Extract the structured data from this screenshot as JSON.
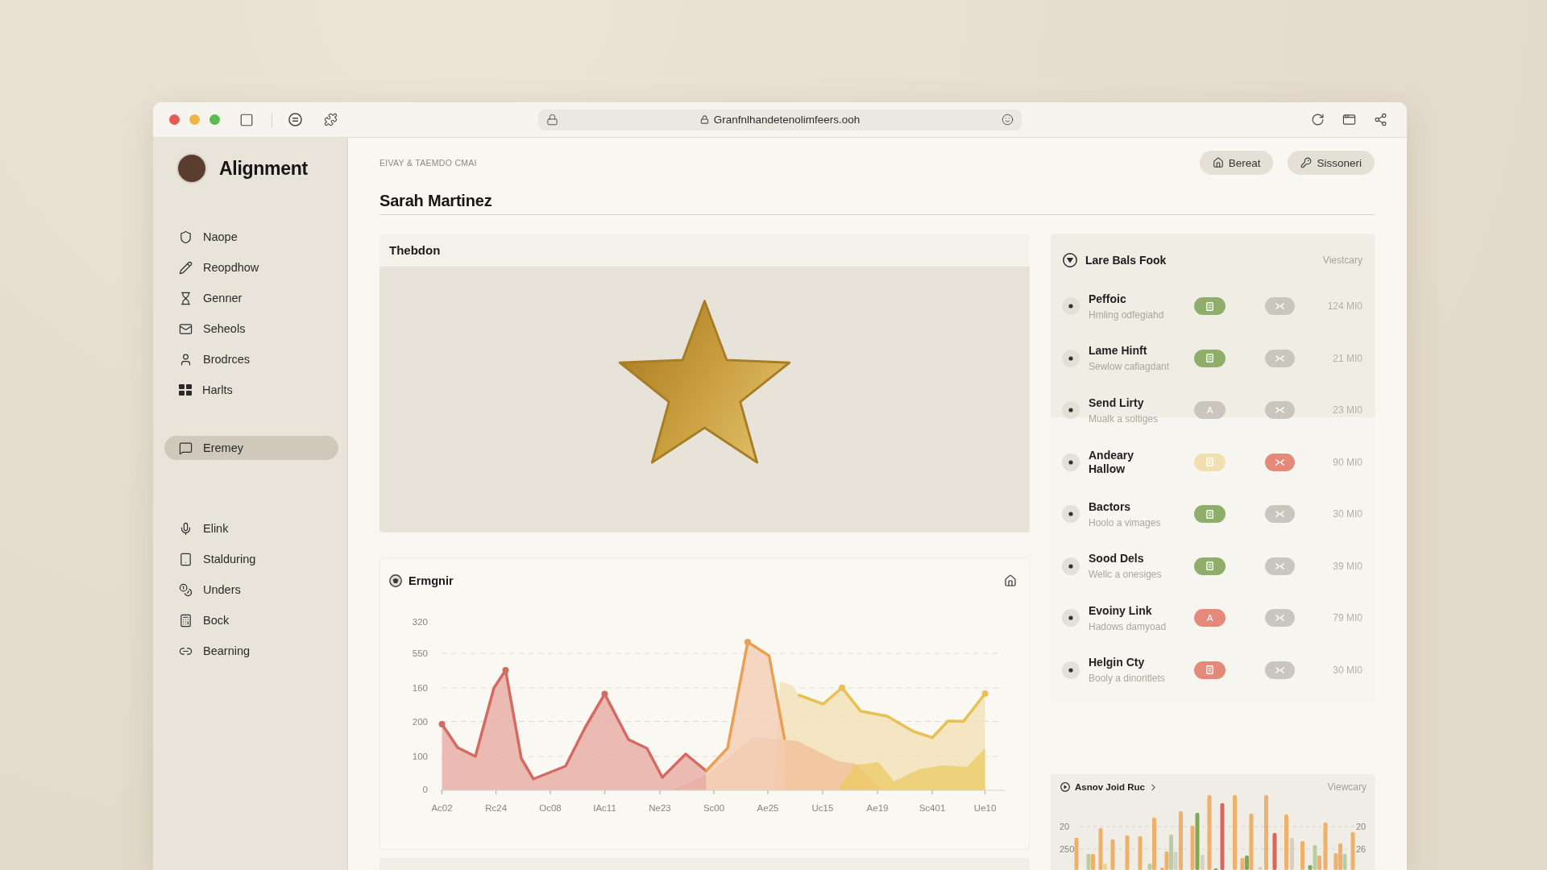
{
  "browser": {
    "url": "Granfnlhandetenolimfeers.ooh"
  },
  "sidebar": {
    "brand": "Alignment",
    "sections": [
      {
        "items": [
          {
            "label": "Naope",
            "selected": false
          },
          {
            "label": "Reopdhow",
            "selected": false
          },
          {
            "label": "Genner",
            "selected": false
          },
          {
            "label": "Seheols",
            "selected": false
          },
          {
            "label": "Brodrces",
            "selected": false
          },
          {
            "label": "Harlts",
            "selected": false
          }
        ]
      },
      {
        "items": [
          {
            "label": "Eremey",
            "selected": true
          }
        ]
      },
      {
        "items": [
          {
            "label": "Elink",
            "selected": false
          },
          {
            "label": "Stalduring",
            "selected": false
          },
          {
            "label": "Unders",
            "selected": false
          },
          {
            "label": "Bock",
            "selected": false
          },
          {
            "label": "Bearning",
            "selected": false
          }
        ]
      }
    ]
  },
  "header": {
    "breadcrumb": "EIVAY & TAEMDO CMAI",
    "title": "Sarah Martinez",
    "actions": [
      {
        "label": "Bereat"
      },
      {
        "label": "Sissoneri"
      }
    ]
  },
  "image_card": {
    "title": "Thebdon"
  },
  "chart_card": {
    "title": "Ermgnir",
    "y_labels": [
      "320",
      "550",
      "160",
      "200",
      "100",
      "0"
    ],
    "x_labels": [
      "Ac02",
      "Rc24",
      "Oc08",
      "IAc11",
      "Ne23",
      "Sc00",
      "Ae25",
      "Uc15",
      "Ae19",
      "Sc401",
      "Ue10"
    ]
  },
  "list_panel": {
    "title": "Lare Bals Fook",
    "link": "Viestcary",
    "rows": [
      {
        "name": "Peffoic",
        "subtitle": "Hmling odfegiahd",
        "tag": {
          "color": "#8fae6c"
        },
        "flag": {
          "color": "#cbc6bd"
        },
        "value": "124 MI0"
      },
      {
        "name": "Lame Hinft",
        "subtitle": "Sewlow cafiagdant",
        "tag": {
          "color": "#8fae6c"
        },
        "flag": {
          "color": "#cbc6bd"
        },
        "value": "21 MI0"
      },
      {
        "name": "Send Lirty",
        "subtitle": "Mualk a soltiges",
        "tag": {
          "color": "#cbc6bd",
          "label": "A"
        },
        "flag": {
          "color": "#cbc6bd"
        },
        "value": "23 MI0"
      },
      {
        "name": "Andeary Hallow",
        "tag": {
          "color": "#f1dfb2"
        },
        "flag": {
          "color": "#e5897a"
        },
        "value": "90 MI0"
      },
      {
        "name": "Bactors",
        "subtitle": "Hoolo a vimages",
        "tag": {
          "color": "#8fae6c"
        },
        "flag": {
          "color": "#cbc6bd"
        },
        "value": "30 MI0"
      },
      {
        "name": "Sood Dels",
        "subtitle": "Wellc a onesiges",
        "tag": {
          "color": "#8fae6c"
        },
        "flag": {
          "color": "#cbc6bd"
        },
        "value": "39 MI0"
      },
      {
        "name": "Evoiny Link",
        "subtitle": "Hadows damyoad",
        "tag": {
          "color": "#e5897a",
          "label": "A"
        },
        "flag": {
          "color": "#cbc6bd"
        },
        "value": "79 MI0"
      },
      {
        "name": "Helgin Cty",
        "subtitle": "Booly a dinoritlets",
        "tag": {
          "color": "#e5897a"
        },
        "flag": {
          "color": "#cbc6bd"
        },
        "value": "30 MI0"
      }
    ]
  },
  "bar_card": {
    "title": "Asnov Joid Ruc",
    "link": "Viewcary",
    "left_labels": [
      "20",
      "250"
    ],
    "right_labels": [
      "20",
      "26"
    ]
  }
}
